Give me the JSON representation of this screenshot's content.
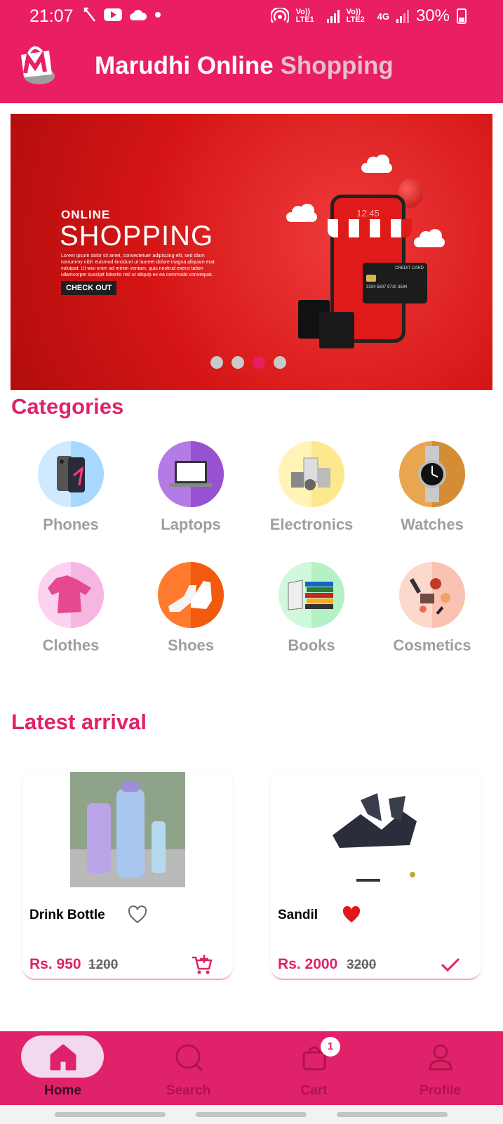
{
  "status_bar": {
    "time": "21:07",
    "net1": "Vo)) LTE1",
    "net2": "Vo)) LTE2",
    "net3": "4G",
    "battery": "30%"
  },
  "app_bar": {
    "title_main": "Marudhi Online",
    "title_accent": "Shopping"
  },
  "banner": {
    "label_small": "ONLINE",
    "label_big": "SHOPPING",
    "body": "Lorem ipsum dolor sit amet, consectetuer adipiscing elit, sed diam nonummy nibh euismod tincidunt ut laoreet dolore magna aliquam erat volutpat. Ut wisi enim ad minim veniam, quis nostrud exerci tation ullamcorper suscipit lobortis nisl ut aliquip ex ea commodo consequat.",
    "button": "CHECK OUT",
    "phone_time": "12:45",
    "card_label": "CREDIT CARD",
    "card_number": "3334 5697 9710 3594",
    "slides": 4,
    "active_slide": 3
  },
  "categories": {
    "title": "Categories",
    "items": [
      {
        "label": "Phones",
        "color": "#cfeaff"
      },
      {
        "label": "Laptops",
        "color": "#a05ad8"
      },
      {
        "label": "Electronics",
        "color": "#fff0a6"
      },
      {
        "label": "Watches",
        "color": "#e3a24e"
      },
      {
        "label": "Clothes",
        "color": "#f9c6ea"
      },
      {
        "label": "Shoes",
        "color": "#ff6d1f"
      },
      {
        "label": "Books",
        "color": "#c6f7d4"
      },
      {
        "label": "Cosmetics",
        "color": "#fdd1c4"
      }
    ]
  },
  "latest": {
    "title": "Latest arrival",
    "products": [
      {
        "name": "Drink Bottle",
        "price": "Rs. 950",
        "old_price": "1200",
        "favorite": false,
        "in_cart": false
      },
      {
        "name": "Sandil",
        "price": "Rs. 2000",
        "old_price": "3200",
        "favorite": true,
        "in_cart": true
      }
    ]
  },
  "bottom_nav": {
    "items": [
      {
        "label": "Home",
        "icon": "home-icon"
      },
      {
        "label": "Search",
        "icon": "search-icon"
      },
      {
        "label": "Cart",
        "icon": "cart-icon"
      },
      {
        "label": "Profile",
        "icon": "profile-icon"
      }
    ],
    "active_index": 0,
    "cart_badge": "1"
  },
  "colors": {
    "primary": "#e91e63",
    "accent_text": "#e0226a"
  }
}
